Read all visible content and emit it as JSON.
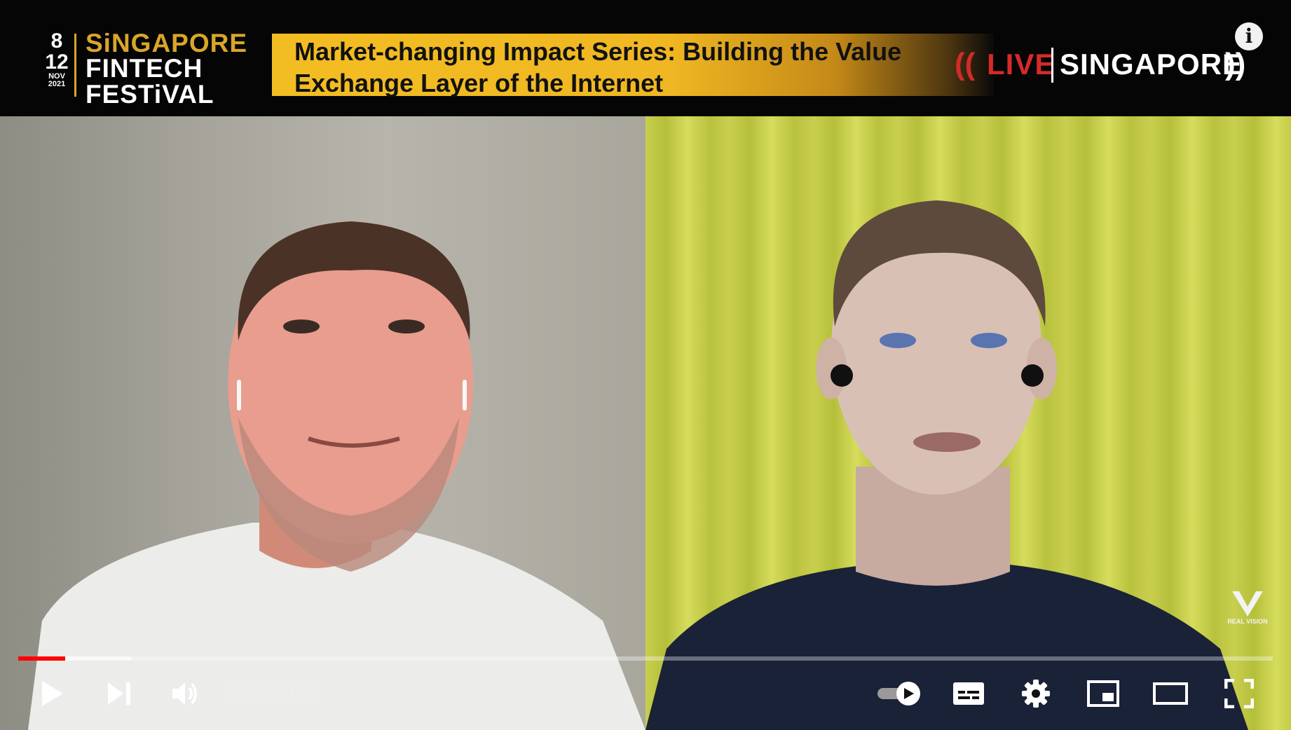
{
  "banner": {
    "logo": {
      "date_start": "8",
      "date_end": "12",
      "month": "NOV",
      "year": "2021",
      "line1": "SiNGAPORE",
      "line2": "FINTECH",
      "line3": "FESTiVAL"
    },
    "title": "Market-changing Impact Series: Building the Value Exchange Layer of the Internet",
    "live_label": "LIVE",
    "city_label": "SINGAPORE"
  },
  "player": {
    "info_icon": "info-icon",
    "time_current": "0:55",
    "time_total": "24:34",
    "time_display": "0:55 / 24:34",
    "progress_played_fraction": 0.0373,
    "progress_buffered_fraction": 0.09,
    "autoplay_enabled": true,
    "watermark_text": "REAL VISION",
    "controls": {
      "play": "play-icon",
      "next": "next-icon",
      "volume": "volume-icon",
      "autoplay": "autoplay-toggle-icon",
      "subtitles": "subtitles-icon",
      "settings": "gear-icon",
      "miniplayer": "miniplayer-icon",
      "theater": "theater-mode-icon",
      "fullscreen": "fullscreen-icon"
    },
    "colors": {
      "progress": "#ff0000",
      "banner_accent": "#f2bd22",
      "live_red": "#d52a2a"
    }
  }
}
